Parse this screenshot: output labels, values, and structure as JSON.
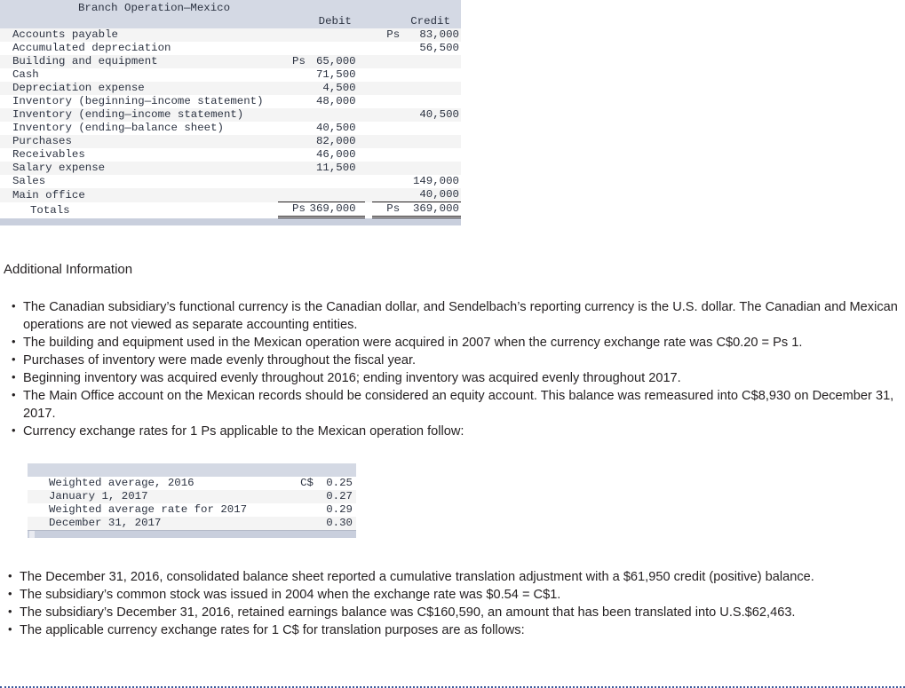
{
  "trial_balance": {
    "title": "Branch Operation—Mexico",
    "columns": {
      "debit": "Debit",
      "credit": "Credit"
    },
    "rows": [
      {
        "label": "Accounts payable",
        "debit_cur": "",
        "debit": "",
        "credit_cur": "Ps",
        "credit": "83,000"
      },
      {
        "label": "Accumulated depreciation",
        "debit_cur": "",
        "debit": "",
        "credit_cur": "",
        "credit": "56,500"
      },
      {
        "label": "Building and equipment",
        "debit_cur": "Ps",
        "debit": "65,000",
        "credit_cur": "",
        "credit": ""
      },
      {
        "label": "Cash",
        "debit_cur": "",
        "debit": "71,500",
        "credit_cur": "",
        "credit": ""
      },
      {
        "label": "Depreciation expense",
        "debit_cur": "",
        "debit": "4,500",
        "credit_cur": "",
        "credit": ""
      },
      {
        "label": "Inventory (beginning—income statement)",
        "debit_cur": "",
        "debit": "48,000",
        "credit_cur": "",
        "credit": ""
      },
      {
        "label": "Inventory (ending—income statement)",
        "debit_cur": "",
        "debit": "",
        "credit_cur": "",
        "credit": "40,500"
      },
      {
        "label": "Inventory (ending—balance sheet)",
        "debit_cur": "",
        "debit": "40,500",
        "credit_cur": "",
        "credit": ""
      },
      {
        "label": "Purchases",
        "debit_cur": "",
        "debit": "82,000",
        "credit_cur": "",
        "credit": ""
      },
      {
        "label": "Receivables",
        "debit_cur": "",
        "debit": "46,000",
        "credit_cur": "",
        "credit": ""
      },
      {
        "label": "Salary expense",
        "debit_cur": "",
        "debit": "11,500",
        "credit_cur": "",
        "credit": ""
      },
      {
        "label": "Sales",
        "debit_cur": "",
        "debit": "",
        "credit_cur": "",
        "credit": "149,000"
      },
      {
        "label": "Main office",
        "debit_cur": "",
        "debit": "",
        "credit_cur": "",
        "credit": "40,000"
      }
    ],
    "totals": {
      "label": "Totals",
      "debit_cur": "Ps",
      "debit": "369,000",
      "credit_cur": "Ps",
      "credit": "369,000"
    }
  },
  "additional": {
    "heading": "Additional Information",
    "bullets": [
      "The Canadian subsidiary’s functional currency is the Canadian dollar, and Sendelbach’s reporting currency is the U.S. dollar. The Canadian and Mexican operations are not viewed as separate accounting entities.",
      "The building and equipment used in the Mexican operation were acquired in 2007 when the currency exchange rate was C$0.20 = Ps 1.",
      "Purchases of inventory were made evenly throughout the fiscal year.",
      "Beginning inventory was acquired evenly throughout 2016; ending inventory was acquired evenly throughout 2017.",
      "The Main Office account on the Mexican records should be considered an equity account. This balance was remeasured into C$8,930 on December 31, 2017.",
      "Currency exchange rates for 1 Ps applicable to the Mexican operation follow:"
    ]
  },
  "rates_table": {
    "rows": [
      {
        "label": "Weighted average, 2016",
        "cur": "C$",
        "value": "0.25"
      },
      {
        "label": "January 1, 2017",
        "cur": "",
        "value": "0.27"
      },
      {
        "label": "Weighted average rate for 2017",
        "cur": "",
        "value": "0.29"
      },
      {
        "label": "December 31, 2017",
        "cur": "",
        "value": "0.30"
      }
    ]
  },
  "additional2": {
    "bullets": [
      "The December 31, 2016, consolidated balance sheet reported a cumulative translation adjustment with a $61,950 credit (positive) balance.",
      "The subsidiary’s common stock was issued in 2004 when the exchange rate was $0.54 = C$1.",
      "The subsidiary’s December 31, 2016, retained earnings balance was C$160,590, an amount that has been translated into U.S.$62,463.",
      "The applicable currency exchange rates for 1 C$ for translation purposes are as follows:"
    ]
  },
  "colors": {
    "table_header_bg": "#d4d9e4",
    "table_footer_bg": "#c9cfdd",
    "stripe_bg": "#f4f4f4",
    "mono_text": "#2c3342",
    "body_text": "#231f20",
    "rule_blue": "#3d5a9e"
  }
}
